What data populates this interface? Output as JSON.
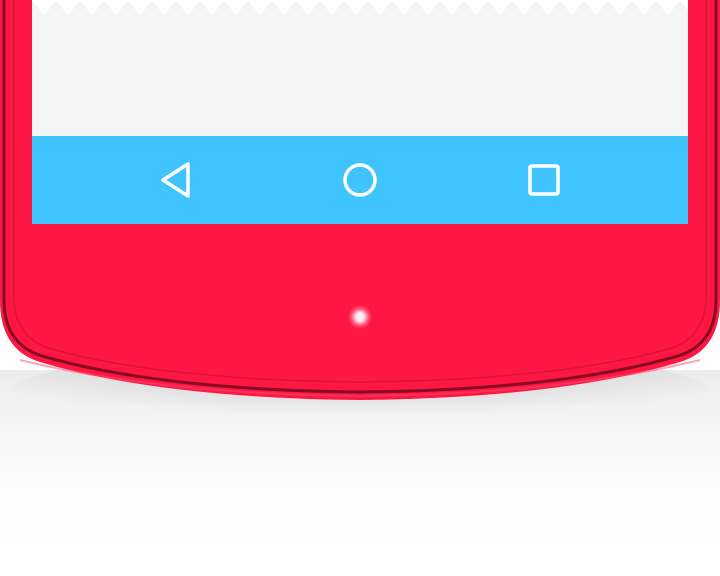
{
  "device": {
    "body_color": "#ff1744",
    "body_edge_color": "#7a0a1f",
    "screen_color": "#f5f5f5",
    "notification_led": {
      "color": "#ffffff",
      "state": "on"
    }
  },
  "navigation_bar": {
    "color": "#40c4ff",
    "icon_color": "#ffffff",
    "buttons": [
      {
        "id": "back",
        "icon": "back-triangle-icon"
      },
      {
        "id": "home",
        "icon": "home-circle-icon"
      },
      {
        "id": "recents",
        "icon": "recents-square-icon"
      }
    ]
  }
}
